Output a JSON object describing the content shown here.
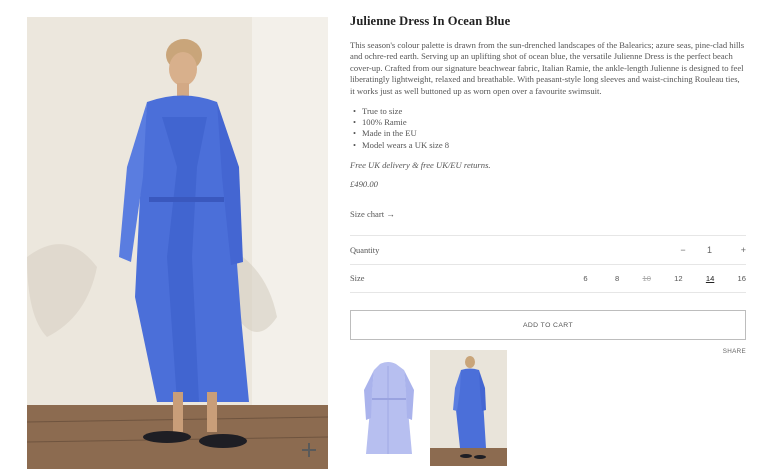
{
  "product": {
    "title": "Julienne Dress In Ocean Blue",
    "description": "This season's colour palette is drawn from the sun-drenched landscapes of the Balearics; azure seas, pine-clad hills and ochre-red earth. Serving up an uplifting shot of ocean blue, the versatile Julienne Dress is the perfect beach cover-up.  Crafted from our signature beachwear fabric, Italian Ramie, the ankle-length Julienne is designed to feel liberatingly lightweight, relaxed and breathable. With peasant-style long sleeves and waist-cinching Rouleau ties, it works just as well buttoned up as worn open over a favourite swimsuit.",
    "bullets": [
      "True to size",
      "100% Ramie",
      "Made in the EU",
      "Model wears a UK size 8"
    ],
    "delivery": "Free UK delivery & free UK/EU returns.",
    "price": "£490.00"
  },
  "size_chart_link": "Size chart →",
  "quantity": {
    "label": "Quantity",
    "minus": "−",
    "value": "1",
    "plus": "+"
  },
  "size": {
    "label": "Size",
    "options": [
      "6",
      "8",
      "10",
      "12",
      "14",
      "16"
    ],
    "selected": "14",
    "unavailable": [
      "10"
    ]
  },
  "add_to_cart_label": "ADD TO CART",
  "share_label": "SHARE",
  "icons": {
    "zoom": "plus-icon"
  },
  "colors": {
    "dress": "#4a6fd8",
    "wall": "#ebe6dc",
    "floor": "#8a6a52"
  }
}
